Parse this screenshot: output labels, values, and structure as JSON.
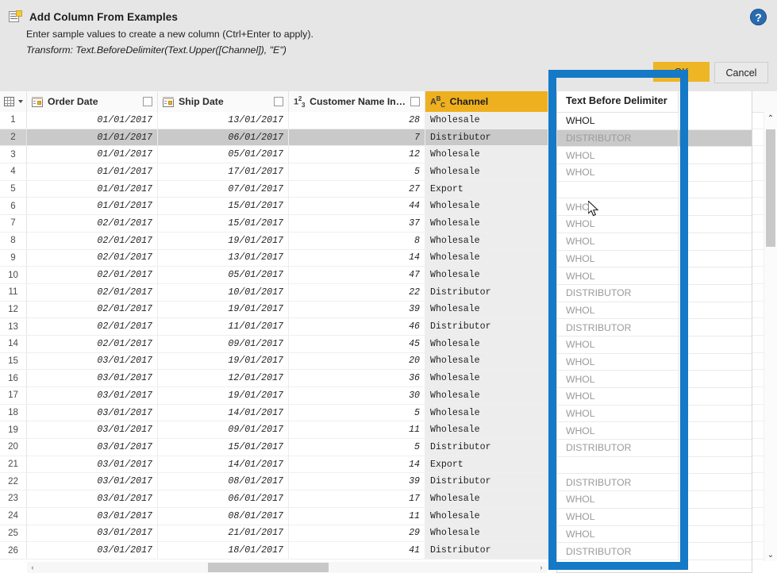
{
  "dialog": {
    "icon": "add-column-icon",
    "title": "Add Column From Examples",
    "subtitle": "Enter sample values to create a new column (Ctrl+Enter to apply).",
    "transform": "Transform: Text.BeforeDelimiter(Text.Upper([Channel]), \"E\")",
    "help_icon": "help-icon",
    "help_glyph": "?",
    "ok_label": "OK",
    "cancel_label": "Cancel",
    "ok_color": "#eeb625"
  },
  "grid": {
    "corner_icon": "select-all-table-icon",
    "columns": [
      {
        "label": "Order Date",
        "type_icon": "date-icon",
        "type_glyph": "",
        "selected": false,
        "has_checkbox": true,
        "quality": "#00b6a6"
      },
      {
        "label": "Ship Date",
        "type_icon": "date-icon",
        "type_glyph": "",
        "selected": false,
        "has_checkbox": true,
        "quality": "#00b6a6"
      },
      {
        "label": "Customer Name Index",
        "type_icon": "number-icon",
        "type_glyph": "123",
        "selected": false,
        "has_checkbox": true,
        "quality": "#00b6a6"
      },
      {
        "label": "Channel",
        "type_icon": "text-icon",
        "type_glyph": "ABC",
        "selected": true,
        "has_checkbox": false,
        "quality": "#4aa02c"
      }
    ],
    "selected_row": 2,
    "rows": [
      {
        "n": "1",
        "order_date": "01/01/2017",
        "ship_date": "13/01/2017",
        "index": "28",
        "channel": "Wholesale",
        "result": "WHOL",
        "entered": true
      },
      {
        "n": "2",
        "order_date": "01/01/2017",
        "ship_date": "06/01/2017",
        "index": "7",
        "channel": "Distributor",
        "result": "DISTRIBUTOR",
        "entered": false
      },
      {
        "n": "3",
        "order_date": "01/01/2017",
        "ship_date": "05/01/2017",
        "index": "12",
        "channel": "Wholesale",
        "result": "WHOL",
        "entered": false
      },
      {
        "n": "4",
        "order_date": "01/01/2017",
        "ship_date": "17/01/2017",
        "index": "5",
        "channel": "Wholesale",
        "result": "WHOL",
        "entered": false
      },
      {
        "n": "5",
        "order_date": "01/01/2017",
        "ship_date": "07/01/2017",
        "index": "27",
        "channel": "Export",
        "result": "",
        "entered": false
      },
      {
        "n": "6",
        "order_date": "01/01/2017",
        "ship_date": "15/01/2017",
        "index": "44",
        "channel": "Wholesale",
        "result": "WHOL",
        "entered": false
      },
      {
        "n": "7",
        "order_date": "02/01/2017",
        "ship_date": "15/01/2017",
        "index": "37",
        "channel": "Wholesale",
        "result": "WHOL",
        "entered": false
      },
      {
        "n": "8",
        "order_date": "02/01/2017",
        "ship_date": "19/01/2017",
        "index": "8",
        "channel": "Wholesale",
        "result": "WHOL",
        "entered": false
      },
      {
        "n": "9",
        "order_date": "02/01/2017",
        "ship_date": "13/01/2017",
        "index": "14",
        "channel": "Wholesale",
        "result": "WHOL",
        "entered": false
      },
      {
        "n": "10",
        "order_date": "02/01/2017",
        "ship_date": "05/01/2017",
        "index": "47",
        "channel": "Wholesale",
        "result": "WHOL",
        "entered": false
      },
      {
        "n": "11",
        "order_date": "02/01/2017",
        "ship_date": "10/01/2017",
        "index": "22",
        "channel": "Distributor",
        "result": "DISTRIBUTOR",
        "entered": false
      },
      {
        "n": "12",
        "order_date": "02/01/2017",
        "ship_date": "19/01/2017",
        "index": "39",
        "channel": "Wholesale",
        "result": "WHOL",
        "entered": false
      },
      {
        "n": "13",
        "order_date": "02/01/2017",
        "ship_date": "11/01/2017",
        "index": "46",
        "channel": "Distributor",
        "result": "DISTRIBUTOR",
        "entered": false
      },
      {
        "n": "14",
        "order_date": "02/01/2017",
        "ship_date": "09/01/2017",
        "index": "45",
        "channel": "Wholesale",
        "result": "WHOL",
        "entered": false
      },
      {
        "n": "15",
        "order_date": "03/01/2017",
        "ship_date": "19/01/2017",
        "index": "20",
        "channel": "Wholesale",
        "result": "WHOL",
        "entered": false
      },
      {
        "n": "16",
        "order_date": "03/01/2017",
        "ship_date": "12/01/2017",
        "index": "36",
        "channel": "Wholesale",
        "result": "WHOL",
        "entered": false
      },
      {
        "n": "17",
        "order_date": "03/01/2017",
        "ship_date": "19/01/2017",
        "index": "30",
        "channel": "Wholesale",
        "result": "WHOL",
        "entered": false
      },
      {
        "n": "18",
        "order_date": "03/01/2017",
        "ship_date": "14/01/2017",
        "index": "5",
        "channel": "Wholesale",
        "result": "WHOL",
        "entered": false
      },
      {
        "n": "19",
        "order_date": "03/01/2017",
        "ship_date": "09/01/2017",
        "index": "11",
        "channel": "Wholesale",
        "result": "WHOL",
        "entered": false
      },
      {
        "n": "20",
        "order_date": "03/01/2017",
        "ship_date": "15/01/2017",
        "index": "5",
        "channel": "Distributor",
        "result": "DISTRIBUTOR",
        "entered": false
      },
      {
        "n": "21",
        "order_date": "03/01/2017",
        "ship_date": "14/01/2017",
        "index": "14",
        "channel": "Export",
        "result": "",
        "entered": false
      },
      {
        "n": "22",
        "order_date": "03/01/2017",
        "ship_date": "08/01/2017",
        "index": "39",
        "channel": "Distributor",
        "result": "DISTRIBUTOR",
        "entered": false
      },
      {
        "n": "23",
        "order_date": "03/01/2017",
        "ship_date": "06/01/2017",
        "index": "17",
        "channel": "Wholesale",
        "result": "WHOL",
        "entered": false
      },
      {
        "n": "24",
        "order_date": "03/01/2017",
        "ship_date": "08/01/2017",
        "index": "11",
        "channel": "Wholesale",
        "result": "WHOL",
        "entered": false
      },
      {
        "n": "25",
        "order_date": "03/01/2017",
        "ship_date": "21/01/2017",
        "index": "29",
        "channel": "Wholesale",
        "result": "WHOL",
        "entered": false
      },
      {
        "n": "26",
        "order_date": "03/01/2017",
        "ship_date": "18/01/2017",
        "index": "41",
        "channel": "Distributor",
        "result": "DISTRIBUTOR",
        "entered": false
      }
    ]
  },
  "new_column": {
    "header": "Text Before Delimiter"
  },
  "scrollbars": {
    "up_glyph": "⌃",
    "down_glyph": "⌄",
    "left_glyph": "‹",
    "right_glyph": "›"
  },
  "annotation": {
    "color": "#1479c6"
  }
}
